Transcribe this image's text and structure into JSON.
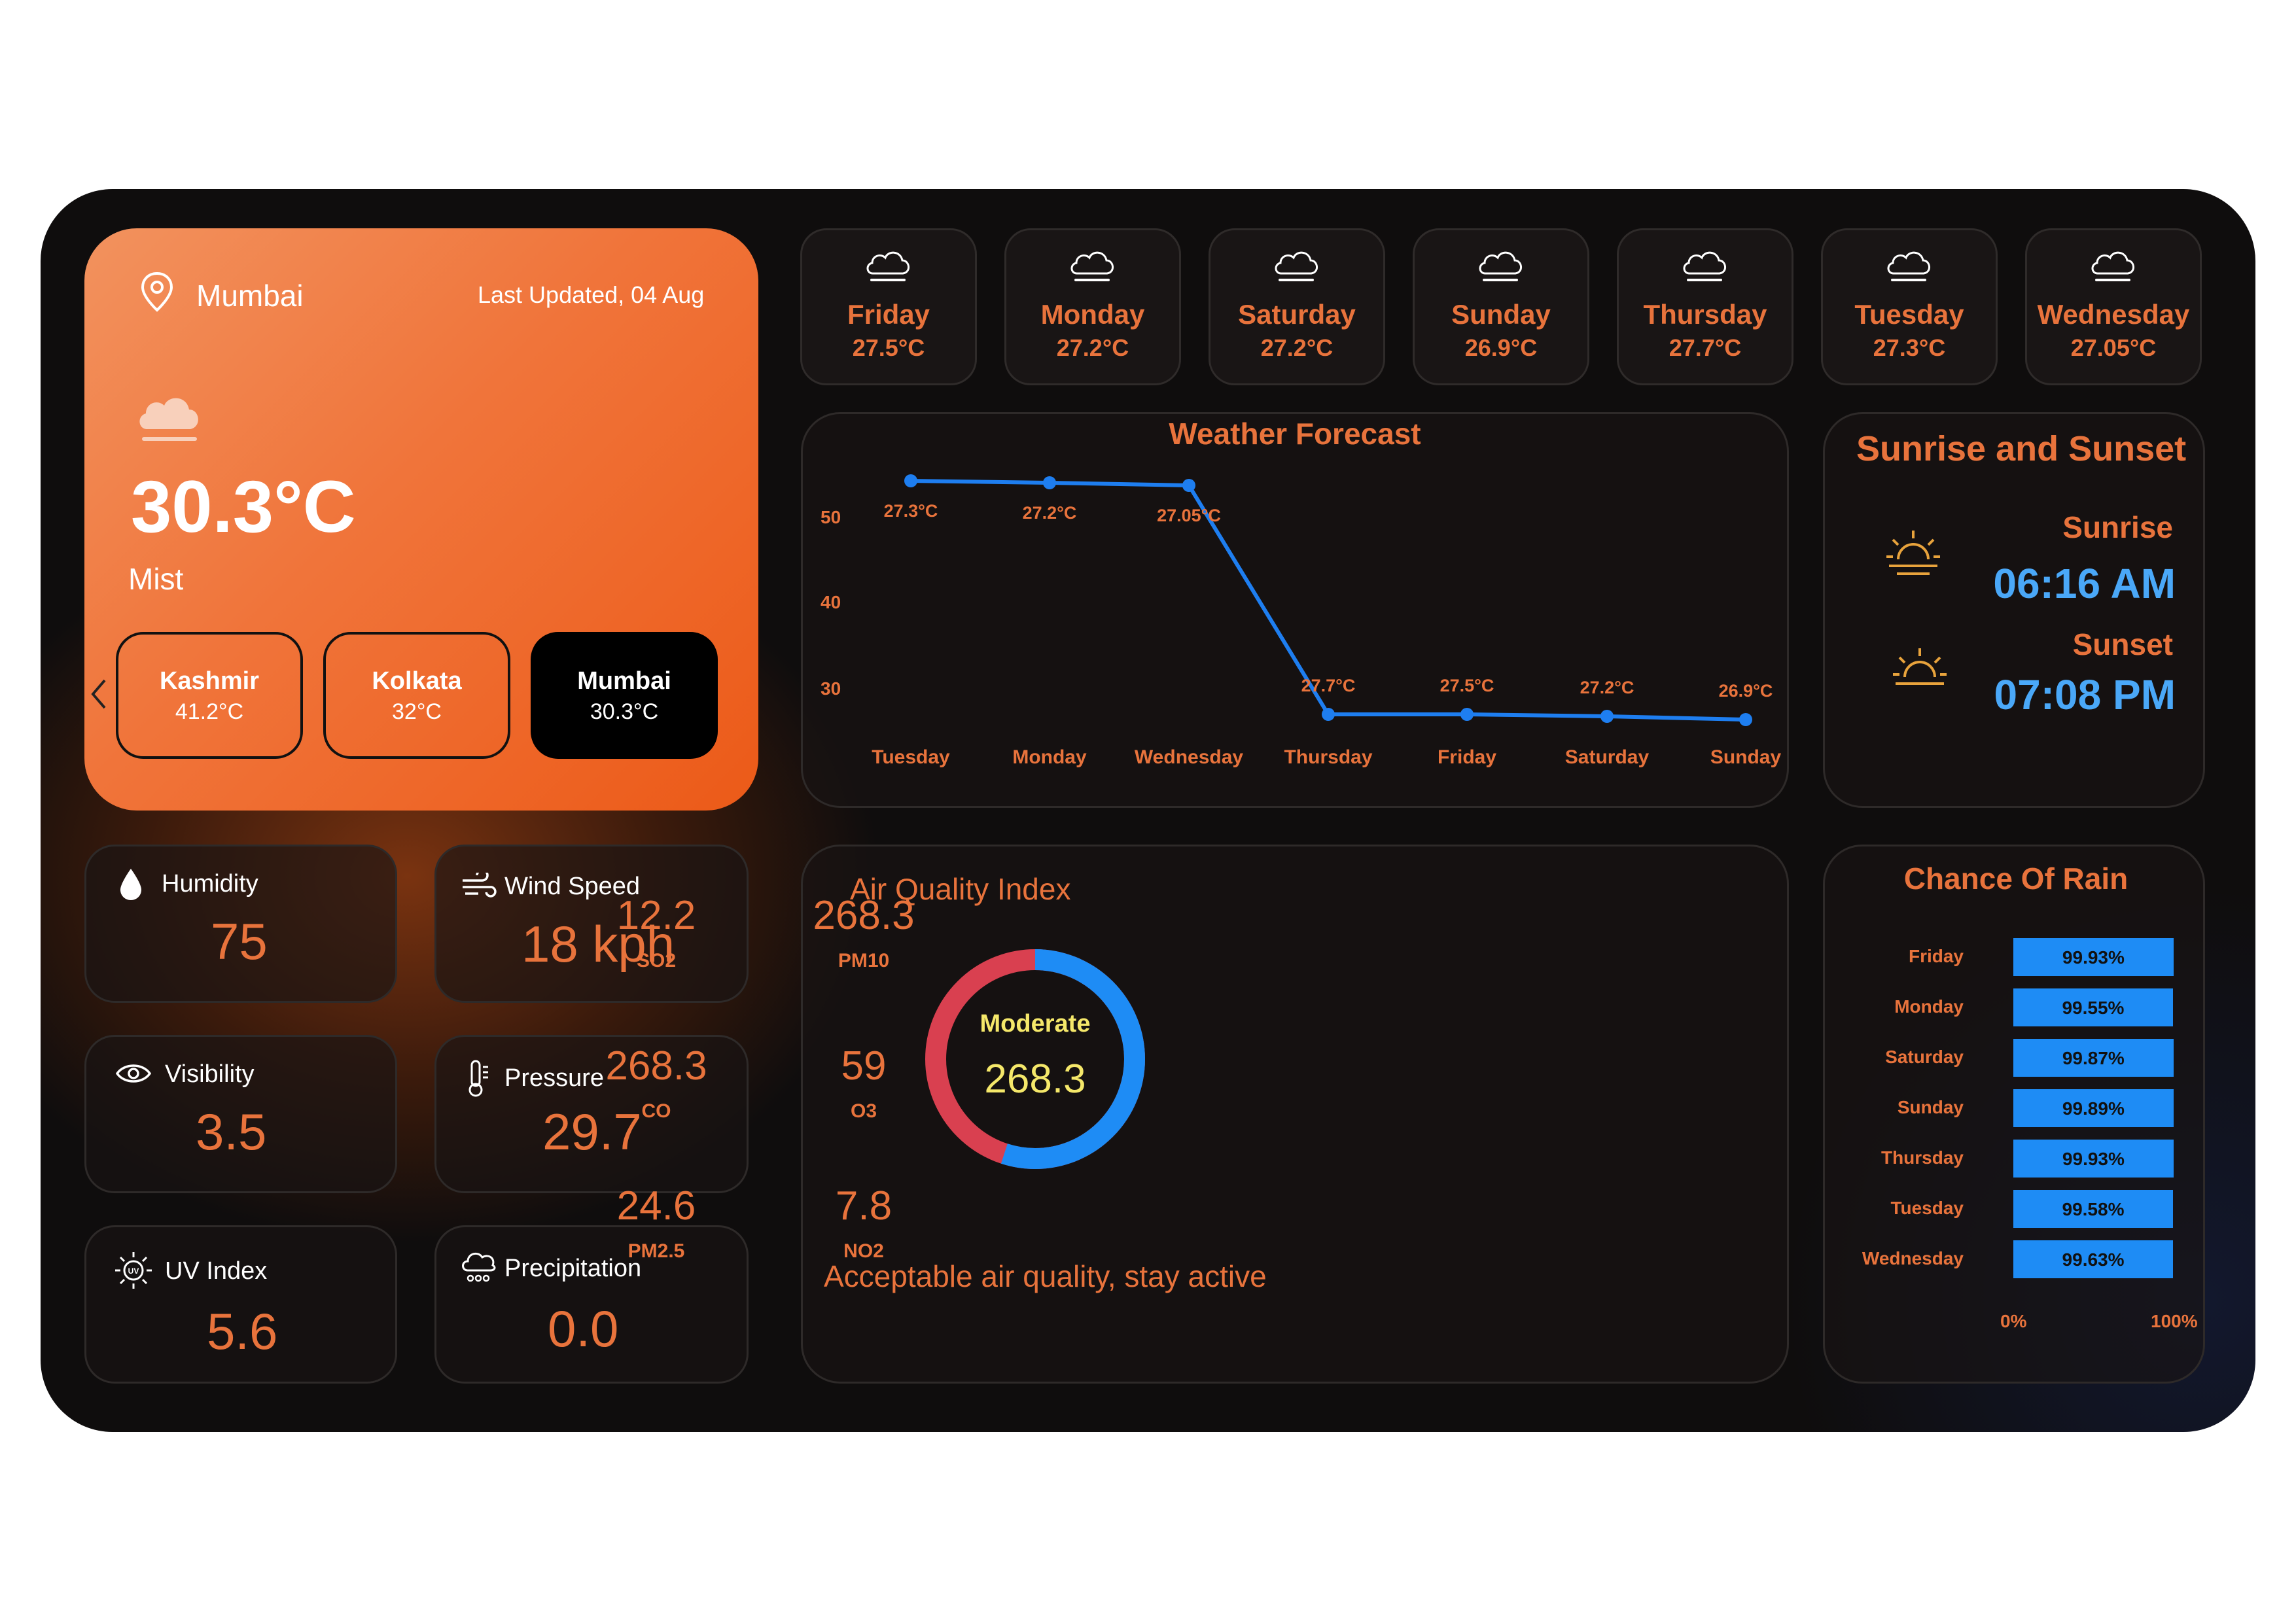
{
  "location": {
    "city": "Mumbai",
    "last_updated": "Last Updated, 04 Aug",
    "temperature": "30.3°C",
    "condition": "Mist",
    "icons": {
      "pin": "location-pin-icon",
      "weather": "cloud-icon",
      "prev": "chevron-left-icon"
    }
  },
  "cities": [
    {
      "name": "Kashmir",
      "temp": "41.2°C",
      "selected": false
    },
    {
      "name": "Kolkata",
      "temp": "32°C",
      "selected": false
    },
    {
      "name": "Mumbai",
      "temp": "30.3°C",
      "selected": true
    }
  ],
  "daily": [
    {
      "day": "Friday",
      "temp": "27.5°C"
    },
    {
      "day": "Monday",
      "temp": "27.2°C"
    },
    {
      "day": "Saturday",
      "temp": "27.2°C"
    },
    {
      "day": "Sunday",
      "temp": "26.9°C"
    },
    {
      "day": "Thursday",
      "temp": "27.7°C"
    },
    {
      "day": "Tuesday",
      "temp": "27.3°C"
    },
    {
      "day": "Wednesday",
      "temp": "27.05°C"
    }
  ],
  "metrics": {
    "humidity": {
      "label": "Humidity",
      "value": "75",
      "icon": "droplet-icon"
    },
    "wind": {
      "label": "Wind Speed",
      "value": "18 kph",
      "icon": "wind-icon"
    },
    "visibility": {
      "label": "Visibility",
      "value": "3.5",
      "icon": "eye-icon"
    },
    "pressure": {
      "label": "Pressure",
      "value": "29.7",
      "icon": "thermometer-icon"
    },
    "uv": {
      "label": "UV Index",
      "value": "5.6",
      "icon": "uv-sun-icon"
    },
    "precipitation": {
      "label": "Precipitation",
      "value": "0.0",
      "icon": "rain-cloud-icon"
    }
  },
  "forecast": {
    "title": "Weather Forecast",
    "chart_data": {
      "type": "line",
      "categories": [
        "Tuesday",
        "Monday",
        "Wednesday",
        "Thursday",
        "Friday",
        "Saturday",
        "Sunday"
      ],
      "values": [
        27.3,
        27.2,
        27.05,
        27.7,
        27.5,
        27.2,
        26.9
      ],
      "labels": [
        "27.3°C",
        "27.2°C",
        "27.05°C",
        "27.7°C",
        "27.5°C",
        "27.2°C",
        "26.9°C"
      ],
      "y_ticks": [
        "50",
        "40",
        "30"
      ],
      "line_color": "#1e7ef0"
    }
  },
  "sun": {
    "title": "Sunrise and Sunset",
    "sunrise_label": "Sunrise",
    "sunrise_time": "06:16 AM",
    "sunset_label": "Sunset",
    "sunset_time": "07:08 PM",
    "icons": {
      "sunrise": "sunrise-icon",
      "sunset": "sunset-icon"
    }
  },
  "aqi": {
    "title": "Air Quality Index",
    "status": "Moderate",
    "value": "268.3",
    "message": "Acceptable air quality, stay active",
    "gauge": {
      "fraction": 0.55,
      "colors": {
        "primary": "#1e8cf5",
        "secondary": "#d94050"
      }
    },
    "pollutants": [
      {
        "value": "12.2",
        "name": "SO2"
      },
      {
        "value": "268.3",
        "name": "PM10"
      },
      {
        "value": "268.3",
        "name": "CO"
      },
      {
        "value": "59",
        "name": "O3"
      },
      {
        "value": "24.6",
        "name": "PM2.5"
      },
      {
        "value": "7.8",
        "name": "NO2"
      }
    ]
  },
  "rain": {
    "title": "Chance Of Rain",
    "chart_data": {
      "type": "bar",
      "categories": [
        "Friday",
        "Monday",
        "Saturday",
        "Sunday",
        "Thursday",
        "Tuesday",
        "Wednesday"
      ],
      "values": [
        99.93,
        99.55,
        99.87,
        99.89,
        99.93,
        99.58,
        99.63
      ],
      "labels": [
        "99.93%",
        "99.55%",
        "99.87%",
        "99.89%",
        "99.93%",
        "99.58%",
        "99.63%"
      ],
      "axis_min": "0%",
      "axis_max": "100%",
      "bar_color": "#1e8cf5"
    }
  }
}
